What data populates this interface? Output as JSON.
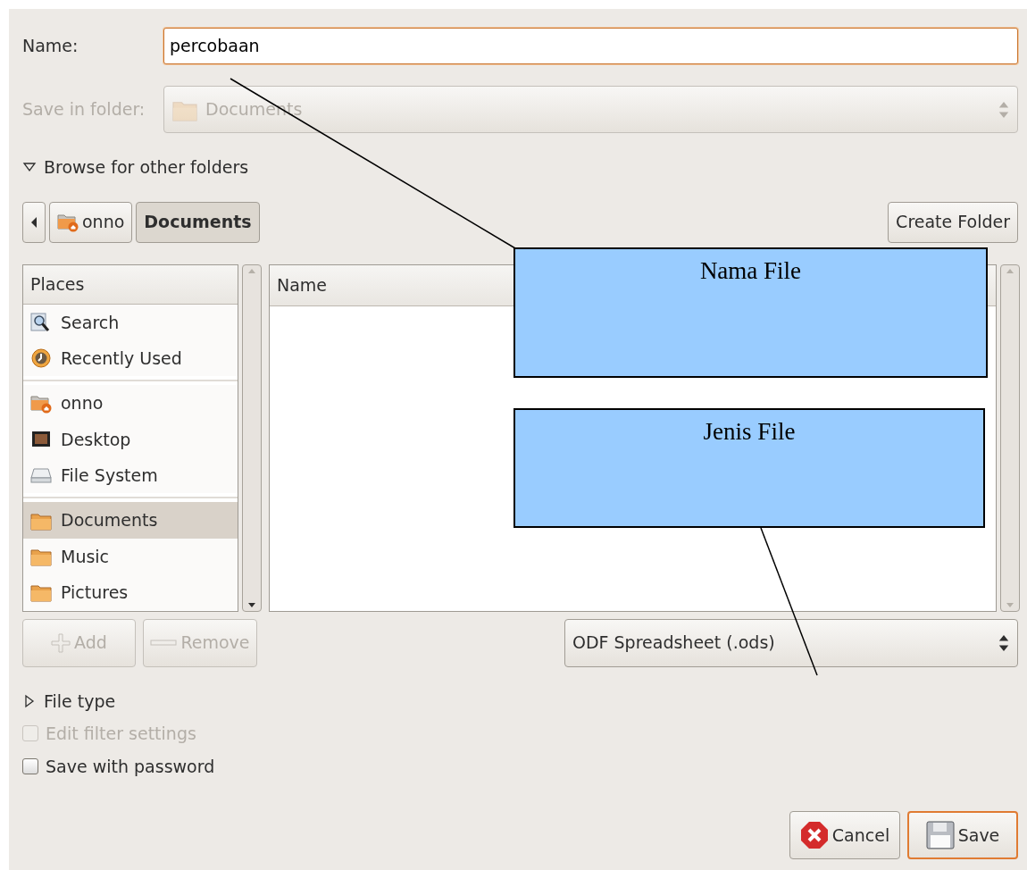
{
  "name_field": {
    "label": "Name:",
    "value": "percobaan",
    "focused": true
  },
  "save_in_folder": {
    "label": "Save in folder:",
    "value": "Documents",
    "disabled": true
  },
  "browse_expander": {
    "label": "Browse for other folders",
    "expanded": true
  },
  "path_bar": [
    {
      "label": "onno",
      "kind": "home",
      "selected": false
    },
    {
      "label": "Documents",
      "kind": "plain",
      "selected": true
    }
  ],
  "create_folder_button": "Create Folder",
  "places": {
    "header": "Places",
    "groups": [
      [
        {
          "label": "Search",
          "kind": "search",
          "selected": false
        },
        {
          "label": "Recently Used",
          "kind": "recent",
          "selected": false
        }
      ],
      [
        {
          "label": "onno",
          "kind": "home",
          "selected": false
        },
        {
          "label": "Desktop",
          "kind": "desktop",
          "selected": false
        },
        {
          "label": "File System",
          "kind": "drive",
          "selected": false
        }
      ],
      [
        {
          "label": "Documents",
          "kind": "folder",
          "selected": true
        },
        {
          "label": "Music",
          "kind": "folder",
          "selected": false
        },
        {
          "label": "Pictures",
          "kind": "folder",
          "selected": false
        }
      ]
    ]
  },
  "file_list": {
    "columns": [
      "Name"
    ]
  },
  "place_buttons": [
    {
      "label": "Add",
      "kind": "add",
      "disabled": true
    },
    {
      "label": "Remove",
      "kind": "remove",
      "disabled": true
    }
  ],
  "file_type_select": "ODF Spreadsheet (.ods)",
  "file_type_expander": {
    "label": "File type",
    "expanded": false
  },
  "options": [
    {
      "label": "Edit filter settings",
      "checked": false,
      "disabled": true
    },
    {
      "label": "Save with password",
      "checked": false,
      "disabled": false
    }
  ],
  "buttons": [
    {
      "label": "Cancel",
      "kind": "cancel",
      "default": false
    },
    {
      "label": "Save",
      "kind": "save",
      "default": true
    }
  ],
  "callouts": [
    {
      "text": "Nama File"
    },
    {
      "text": "Jenis File"
    }
  ]
}
